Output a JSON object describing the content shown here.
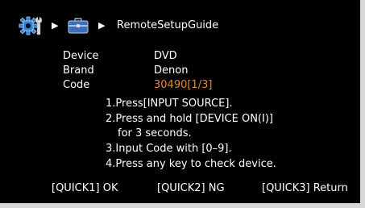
{
  "breadcrumb": {
    "title": "RemoteSetupGuide",
    "icons": [
      "setup-gear-wrench-icon",
      "toolbox-icon"
    ]
  },
  "fields": {
    "device_label": "Device",
    "device_value": "DVD",
    "brand_label": "Brand",
    "brand_value": "Denon",
    "code_label": "Code",
    "code_value": "30490[1/3]"
  },
  "steps": [
    "1.Press[INPUT SOURCE].",
    "2.Press and hold [DEVICE ON(I)]",
    "for 3 seconds.",
    "3.Input Code with [0–9].",
    "4.Press any key to check device."
  ],
  "footer": {
    "quick1": "[QUICK1] OK",
    "quick2": "[QUICK2] NG",
    "quick3": "[QUICK3] Return"
  },
  "colors": {
    "background": "#000000",
    "text": "#ffffff",
    "accent": "#e38a2c",
    "frame": "#d8d8d8"
  }
}
